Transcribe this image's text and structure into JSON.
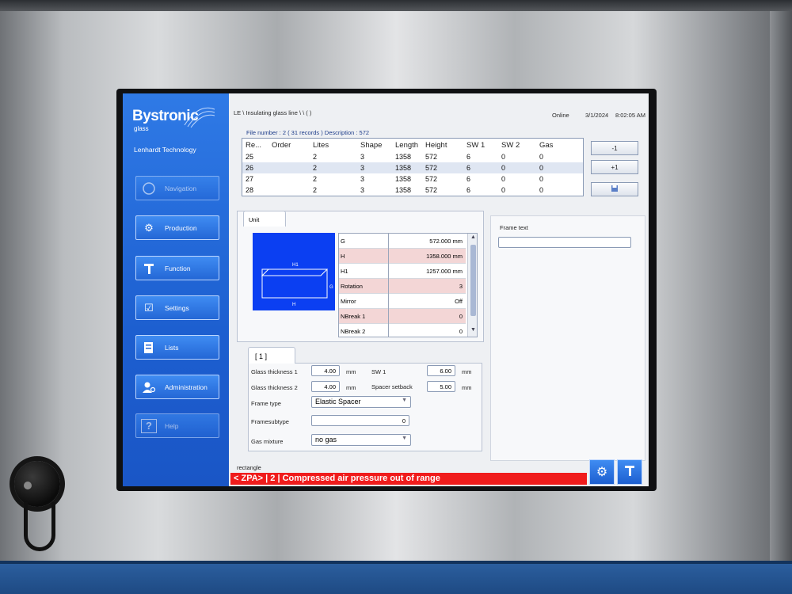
{
  "sidebar": {
    "brand": "Bystronic",
    "brand_sub": "glass",
    "company": "Lenhardt Technology",
    "items": [
      {
        "label": "Navigation",
        "icon": "compass-icon"
      },
      {
        "label": "Production",
        "icon": "gear-icon"
      },
      {
        "label": "Function",
        "icon": "tools-icon"
      },
      {
        "label": "Settings",
        "icon": "checklist-icon"
      },
      {
        "label": "Lists",
        "icon": "list-icon"
      },
      {
        "label": "Administration",
        "icon": "admin-icon"
      },
      {
        "label": "Help",
        "icon": "help-icon"
      }
    ]
  },
  "header": {
    "breadcrumb": "LE \\ Insulating glass line \\ \\ ( )",
    "status": "Online",
    "date": "3/1/2024",
    "time": "8:02:05 AM"
  },
  "file_info": "File number : 2  ( 31 records ) Description : 572",
  "records": {
    "columns": [
      "Re...",
      "Order",
      "Lites",
      "Shape",
      "Length",
      "Height",
      "SW 1",
      "SW 2",
      "Gas"
    ],
    "rows": [
      [
        "25",
        "",
        "2",
        "3",
        "1358",
        "572",
        "6",
        "0",
        "0"
      ],
      [
        "26",
        "",
        "2",
        "3",
        "1358",
        "572",
        "6",
        "0",
        "0"
      ],
      [
        "27",
        "",
        "2",
        "3",
        "1358",
        "572",
        "6",
        "0",
        "0"
      ],
      [
        "28",
        "",
        "2",
        "3",
        "1358",
        "572",
        "6",
        "0",
        "0"
      ]
    ],
    "selected_index": 1
  },
  "record_buttons": {
    "prev": "-1",
    "next": "+1",
    "save_icon": "save-icon"
  },
  "unit": {
    "tab_label": "Unit",
    "preview_labels": {
      "h1": "H1",
      "g": "G",
      "h": "H"
    },
    "params": [
      {
        "name": "G",
        "value": "572.000 mm"
      },
      {
        "name": "H",
        "value": "1358.000 mm"
      },
      {
        "name": "H1",
        "value": "1257.000 mm"
      },
      {
        "name": "Rotation",
        "value": "3"
      },
      {
        "name": "Mirror",
        "value": "Off"
      },
      {
        "name": "NBreak 1",
        "value": "0"
      },
      {
        "name": "NBreak 2",
        "value": "0"
      }
    ]
  },
  "frame_text": {
    "label": "Frame text",
    "value": ""
  },
  "layer": {
    "tab_label": "[ 1 ]",
    "glass_thickness_1": {
      "label": "Glass thickness 1",
      "value": "4.00",
      "unit": "mm"
    },
    "glass_thickness_2": {
      "label": "Glass thickness 2",
      "value": "4.00",
      "unit": "mm"
    },
    "sw1": {
      "label": "SW 1",
      "value": "6.00",
      "unit": "mm"
    },
    "spacer_setback": {
      "label": "Spacer setback",
      "value": "5.00",
      "unit": "mm"
    },
    "frame_type": {
      "label": "Frame type",
      "value": "Elastic Spacer"
    },
    "frame_subtype": {
      "label": "Framesubtype",
      "value": "0"
    },
    "gas_mixture": {
      "label": "Gas mixture",
      "value": "no gas"
    }
  },
  "footer": {
    "shape_text": "rectangle",
    "alarm": "< ZPA> | 2 | Compressed air pressure out of range"
  },
  "colors": {
    "sidebar_blue": "#1d5fd0",
    "preview_blue": "#0b3ff2",
    "alarm_red": "#f01c1c",
    "highlight_pink": "#f3d6d6"
  }
}
